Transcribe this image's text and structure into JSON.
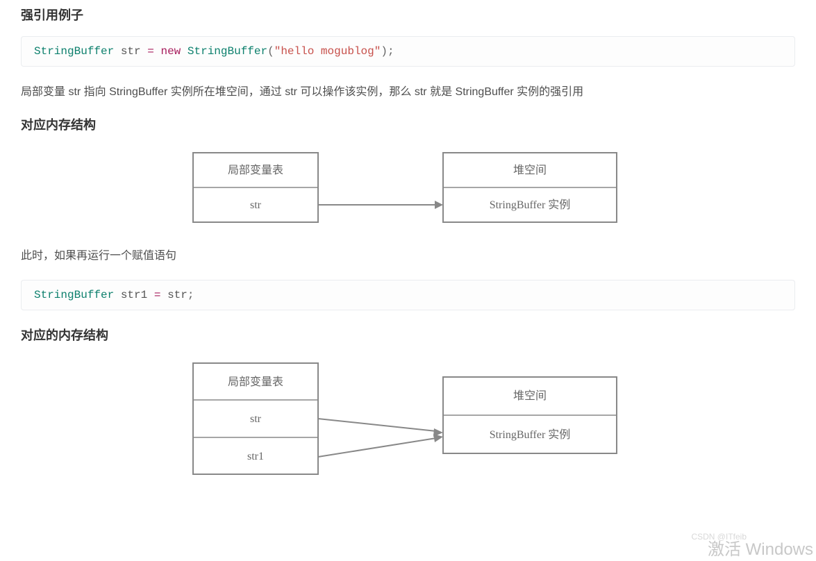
{
  "h_example": "强引用例子",
  "code1": {
    "type1": "StringBuffer",
    "var1": "str",
    "op": "=",
    "kw": "new",
    "type2": "StringBuffer",
    "lp": "(",
    "str": "\"hello mogublog\"",
    "rp": ")",
    "semi": ";"
  },
  "para1": "局部变量 str 指向 StringBuffer 实例所在堆空间，通过 str 可以操作该实例，那么 str 就是 StringBuffer 实例的强引用",
  "h_mem1": "对应内存结构",
  "diag1": {
    "left_header": "局部变量表",
    "left_row1": "str",
    "right_header": "堆空间",
    "right_row1": "StringBuffer 实例"
  },
  "para2": "此时，如果再运行一个赋值语句",
  "code2": {
    "type1": "StringBuffer",
    "var1": "str1",
    "op": "=",
    "var2": "str",
    "semi": ";"
  },
  "h_mem2": "对应的内存结构",
  "diag2": {
    "left_header": "局部变量表",
    "left_row1": "str",
    "left_row2": "str1",
    "right_header": "堆空间",
    "right_row1": "StringBuffer 实例"
  },
  "watermark_small": "CSDN @ITfeib",
  "watermark": "激活 Windows"
}
